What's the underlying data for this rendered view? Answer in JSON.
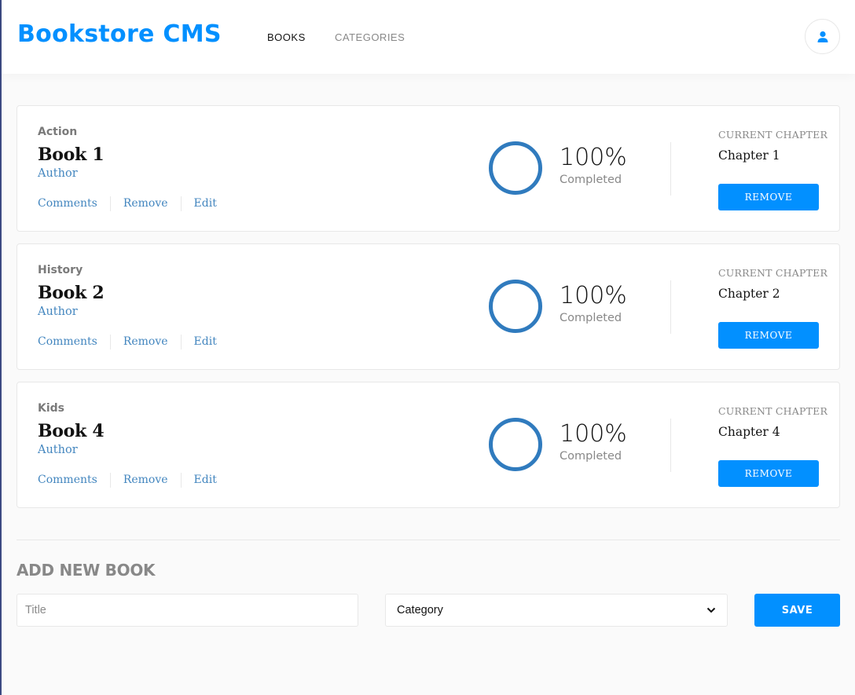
{
  "header": {
    "brand": "Bookstore CMS",
    "nav": [
      "BOOKS",
      "CATEGORIES"
    ],
    "user_icon": "user-icon"
  },
  "books": [
    {
      "genre": "Action",
      "title": "Book 1",
      "author": "Author",
      "actions": [
        "Comments",
        "Remove",
        "Edit"
      ],
      "percent": "100%",
      "progress": 1.0,
      "completed_label": "Completed",
      "current_chapter_label": "CURRENT CHAPTER",
      "chapter": "Chapter 1",
      "remove_button": "REMOVE"
    },
    {
      "genre": "History",
      "title": "Book 2",
      "author": "Author",
      "actions": [
        "Comments",
        "Remove",
        "Edit"
      ],
      "percent": "100%",
      "progress": 1.0,
      "completed_label": "Completed",
      "current_chapter_label": "CURRENT CHAPTER",
      "chapter": "Chapter 2",
      "remove_button": "REMOVE"
    },
    {
      "genre": "Kids",
      "title": "Book 4",
      "author": "Author",
      "actions": [
        "Comments",
        "Remove",
        "Edit"
      ],
      "percent": "100%",
      "progress": 1.0,
      "completed_label": "Completed",
      "current_chapter_label": "CURRENT CHAPTER",
      "chapter": "Chapter 4",
      "remove_button": "REMOVE"
    }
  ],
  "add_book": {
    "heading": "ADD NEW BOOK",
    "title_placeholder": "Title",
    "category_selected": "Category",
    "save_button": "SAVE"
  },
  "colors": {
    "accent": "#0290ff",
    "progress_ring": "#307bbe",
    "link": "#4386bf"
  }
}
